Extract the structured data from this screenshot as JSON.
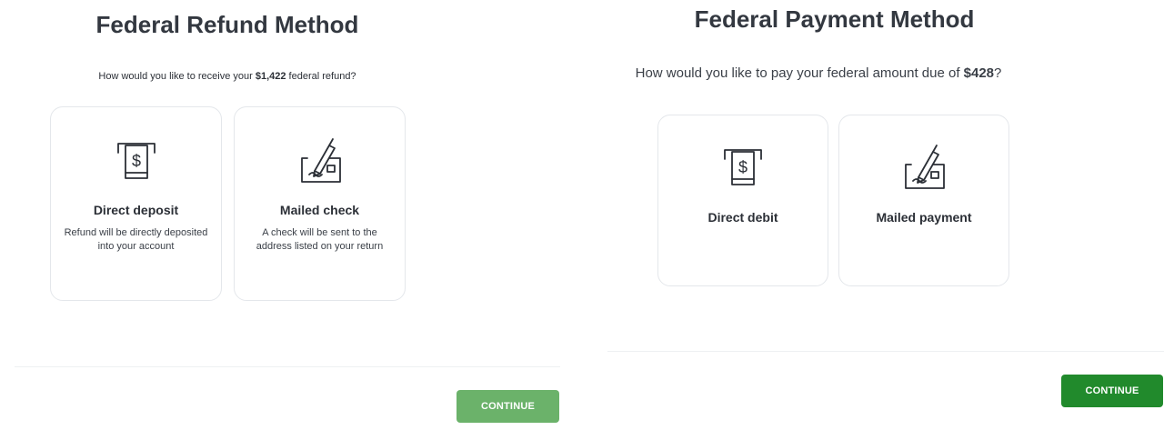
{
  "refund": {
    "title": "Federal Refund Method",
    "question_prefix": "How would you like to receive your ",
    "amount": "$1,422",
    "question_suffix": " federal refund?",
    "options": [
      {
        "label": "Direct deposit",
        "description": "Refund will be directly deposited into your account",
        "icon": "atm-dollar-icon"
      },
      {
        "label": "Mailed check",
        "description": "A check will be sent to the address listed on your return",
        "icon": "check-pen-icon"
      }
    ],
    "continue_label": "CONTINUE",
    "continue_color": "#6bb26a"
  },
  "payment": {
    "title": "Federal Payment Method",
    "question_prefix": "How would you like to pay your federal amount due of ",
    "amount": "$428",
    "question_suffix": "?",
    "options": [
      {
        "label": "Direct debit",
        "icon": "atm-dollar-icon"
      },
      {
        "label": "Mailed payment",
        "icon": "check-pen-icon"
      }
    ],
    "continue_label": "CONTINUE",
    "continue_color": "#218a2c"
  }
}
